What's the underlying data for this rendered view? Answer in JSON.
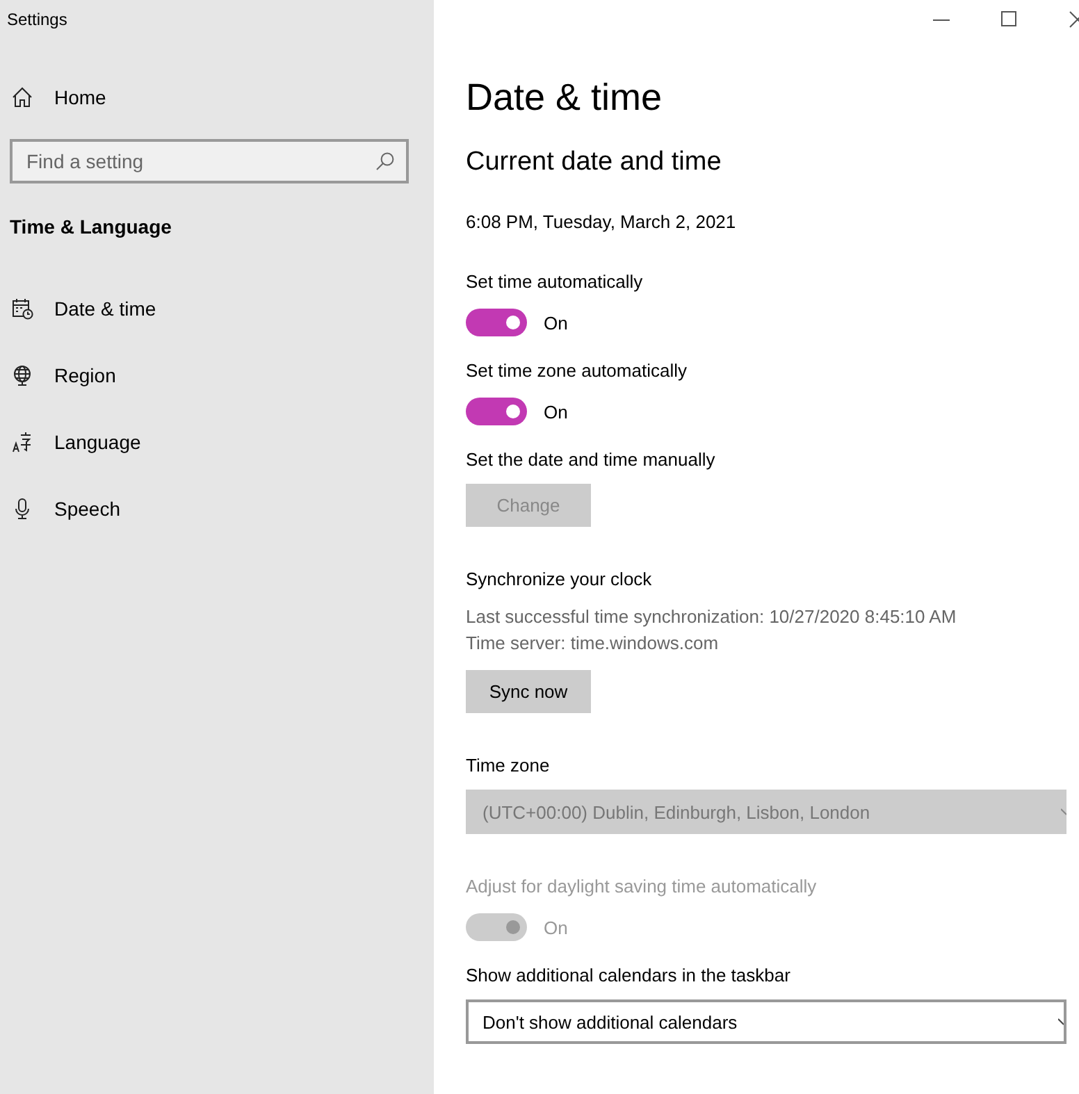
{
  "window": {
    "title": "Settings"
  },
  "sidebar": {
    "home": "Home",
    "search": {
      "placeholder": "Find a setting"
    },
    "section": "Time & Language",
    "items": [
      {
        "label": "Date & time"
      },
      {
        "label": "Region"
      },
      {
        "label": "Language"
      },
      {
        "label": "Speech"
      }
    ]
  },
  "main": {
    "title": "Date & time",
    "section_title": "Current date and time",
    "current_datetime": "6:08 PM, Tuesday, March 2, 2021",
    "settings": [
      {
        "kind": "toggle",
        "label": "Set time automatically",
        "on": true,
        "disabled": false,
        "state_text": "On"
      },
      {
        "kind": "toggle",
        "label": "Set time zone automatically",
        "on": true,
        "disabled": false,
        "state_text": "On"
      },
      {
        "kind": "button",
        "label": "Set the date and time manually",
        "button": "Change",
        "disabled": true
      },
      {
        "kind": "sync",
        "label": "Synchronize your clock",
        "lines": [
          "Last successful time synchronization: 10/27/2020 8:45:10 AM",
          "Time server: time.windows.com"
        ],
        "button": "Sync now",
        "disabled": false
      },
      {
        "kind": "dropdown",
        "label": "Time zone",
        "value": "(UTC+00:00) Dublin, Edinburgh, Lisbon, London",
        "disabled": true
      },
      {
        "kind": "toggle",
        "label": "Adjust for daylight saving time automatically",
        "on": true,
        "disabled": true,
        "state_text": "On"
      },
      {
        "kind": "dropdown",
        "label": "Show additional calendars in the taskbar",
        "value": "Don't show additional calendars",
        "disabled": false
      }
    ]
  }
}
